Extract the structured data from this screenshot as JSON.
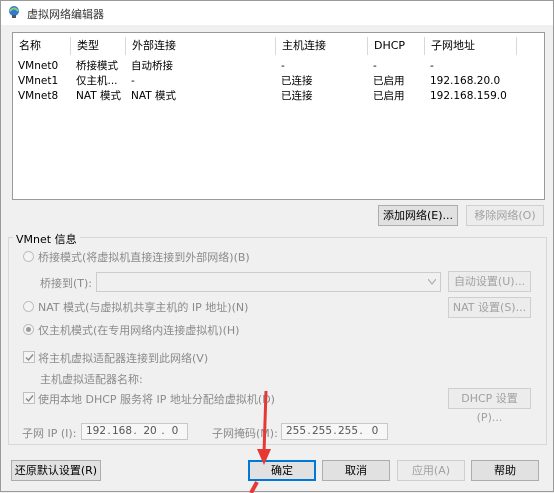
{
  "window": {
    "title": "虚拟网络编辑器"
  },
  "table": {
    "headers": [
      "名称",
      "类型",
      "外部连接",
      "主机连接",
      "DHCP",
      "子网地址"
    ],
    "rows": [
      [
        "VMnet0",
        "桥接模式",
        "自动桥接",
        "-",
        "-",
        "-"
      ],
      [
        "VMnet1",
        "仅主机...",
        "-",
        "已连接",
        "已启用",
        "192.168.20.0"
      ],
      [
        "VMnet8",
        "NAT 模式",
        "NAT 模式",
        "已连接",
        "已启用",
        "192.168.159.0"
      ]
    ]
  },
  "buttons": {
    "add_network": "添加网络(E)...",
    "remove_network": "移除网络(O)",
    "auto_settings": "自动设置(U)...",
    "nat_settings": "NAT 设置(S)...",
    "dhcp_settings": "DHCP 设置(P)...",
    "restore_defaults": "还原默认设置(R)",
    "ok": "确定",
    "cancel": "取消",
    "apply": "应用(A)",
    "help": "帮助"
  },
  "vmnet_info": {
    "group_title": "VMnet 信息",
    "bridged_mode": "桥接模式(将虚拟机直接连接到外部网络)(B)",
    "bridged_to_label": "桥接到(T):",
    "nat_mode": "NAT 模式(与虚拟机共享主机的 IP 地址)(N)",
    "host_only_mode": "仅主机模式(在专用网络内连接虚拟机)(H)",
    "connect_adapter": "将主机虚拟适配器连接到此网络(V)",
    "adapter_name_label": "主机虚拟适配器名称:",
    "use_dhcp": "使用本地 DHCP 服务将 IP 地址分配给虚拟机(D)",
    "subnet_ip_label": "子网 IP (I):",
    "subnet_ip": [
      "192",
      "168",
      "20",
      "0"
    ],
    "subnet_mask_label": "子网掩码(M):",
    "subnet_mask": [
      "255",
      "255",
      "255",
      "0"
    ]
  },
  "state": {
    "selected_mode": "host-only",
    "connect_adapter_checked": true,
    "use_dhcp_checked": true
  },
  "colors": {
    "annotation_arrow": "#e53935",
    "default_button_border": "#0078d7"
  }
}
